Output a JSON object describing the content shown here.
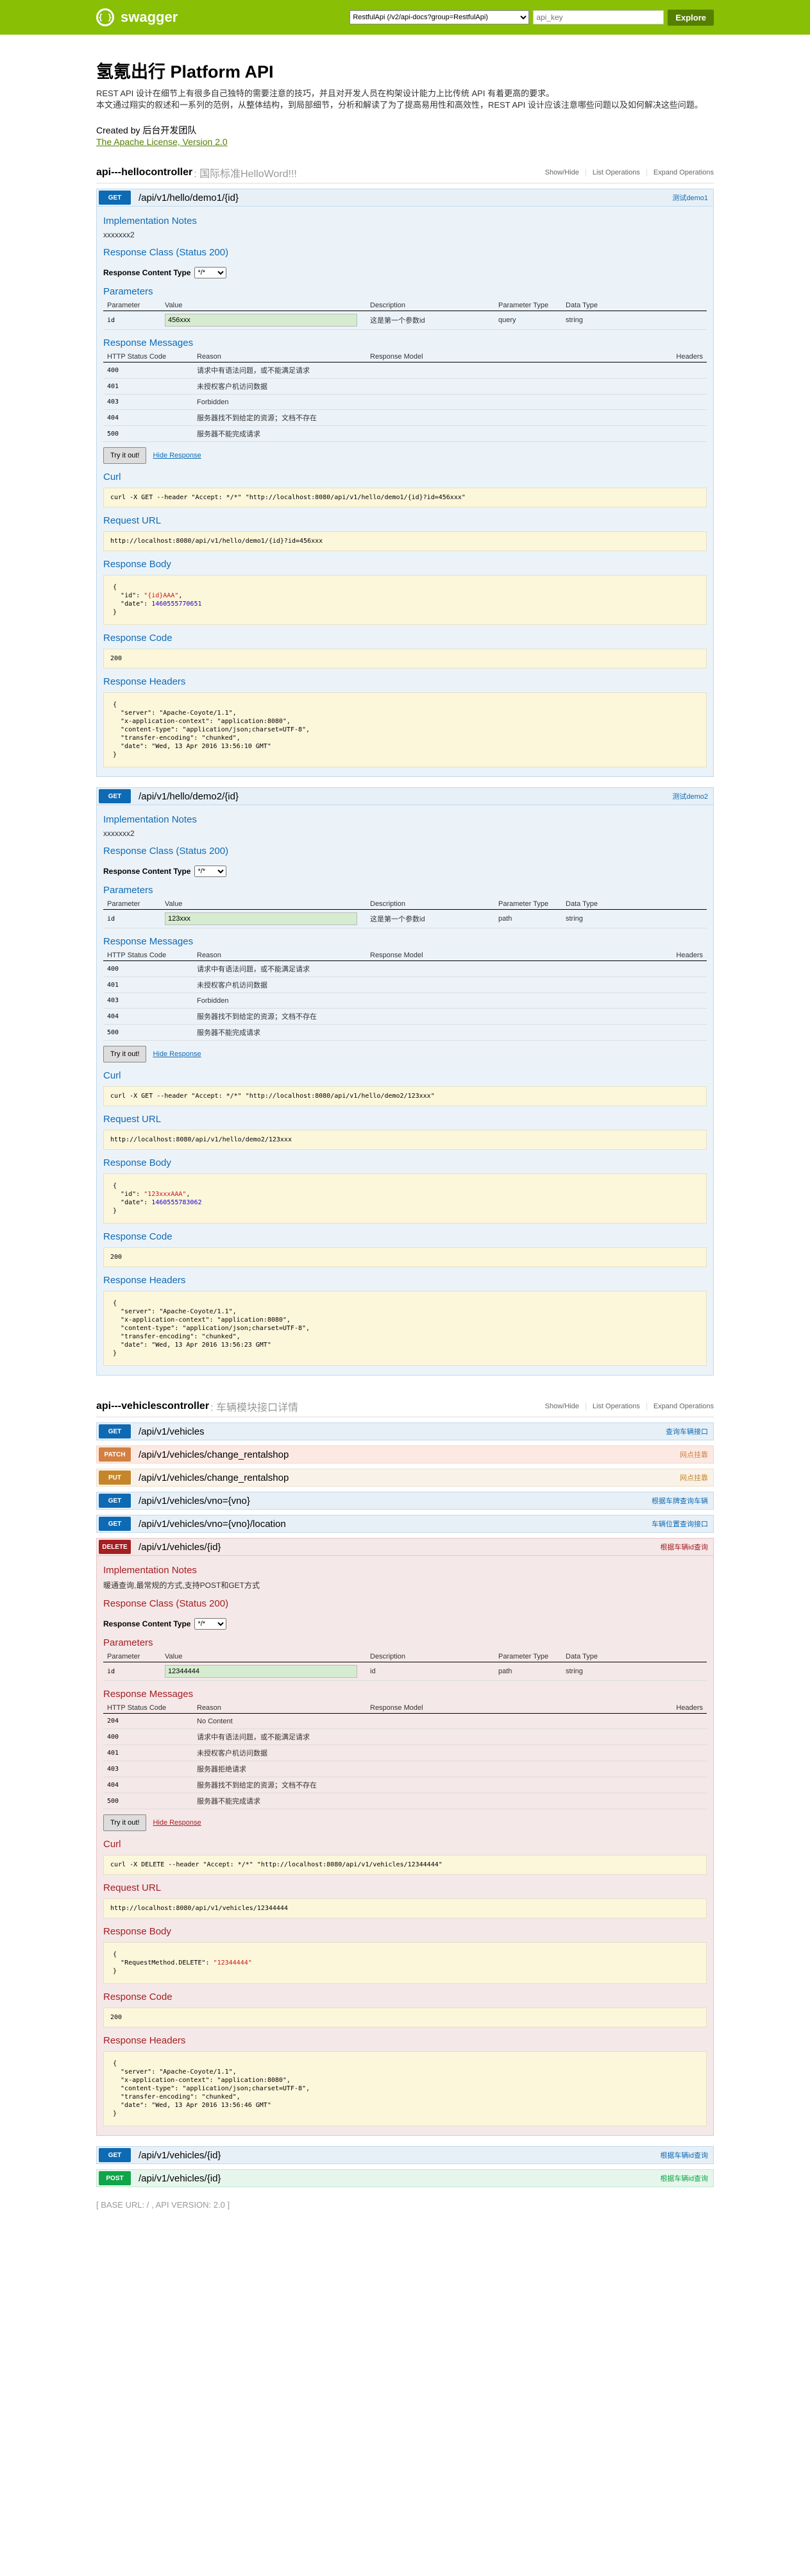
{
  "header": {
    "logo_text": "swagger",
    "logo_icon": "swagger-logo-icon",
    "select_value": "RestfulApi (/v2/api-docs?group=RestfulApi)",
    "input_placeholder": "api_key",
    "explore_label": "Explore"
  },
  "info": {
    "title": "氢氪出行 Platform API",
    "desc_line1": "REST API 设计在细节上有很多自己独特的需要注意的技巧，并且对开发人员在构架设计能力上比传统 API 有着更高的要求。",
    "desc_line2": "本文通过翔实的叙述和一系列的范例，从整体结构，到局部细节，分析和解读了为了提高易用性和高效性，REST API 设计应该注意哪些问题以及如何解决这些问题。",
    "created_by": "Created by 后台开发团队",
    "license": "The Apache License, Version 2.0"
  },
  "resources": {
    "hello": {
      "name": "api---hellocontroller",
      "desc": ": 国际标准HelloWord!!!",
      "links": [
        "Show/Hide",
        "List Operations",
        "Expand Operations"
      ],
      "op1": {
        "method": "GET",
        "path": "/api/v1/hello/demo1/{id}",
        "summary": "测试demo1",
        "notes_label": "Implementation Notes",
        "notes": "xxxxxxx2",
        "response_class": "Response Class (Status 200)",
        "rct_label": "Response Content Type",
        "rct_value": "*/*",
        "params_label": "Parameters",
        "param_headers": [
          "Parameter",
          "Value",
          "Description",
          "Parameter Type",
          "Data Type"
        ],
        "param": {
          "name": "id",
          "value": "456xxx",
          "desc": "这是第一个参数id",
          "type": "query",
          "dtype": "string"
        },
        "messages_label": "Response Messages",
        "msg_headers": [
          "HTTP Status Code",
          "Reason",
          "Response Model",
          "Headers"
        ],
        "messages": [
          {
            "code": "400",
            "reason": "请求中有语法问题，或不能满足请求"
          },
          {
            "code": "401",
            "reason": "未授权客户机访问数据"
          },
          {
            "code": "403",
            "reason": "Forbidden"
          },
          {
            "code": "404",
            "reason": "服务器找不到给定的资源；文档不存在"
          },
          {
            "code": "500",
            "reason": "服务器不能完成请求"
          }
        ],
        "try_label": "Try it out!",
        "hide_label": "Hide Response",
        "curl_label": "Curl",
        "curl": "curl -X GET --header \"Accept: */*\" \"http://localhost:8080/api/v1/hello/demo1/{id}?id=456xxx\"",
        "url_label": "Request URL",
        "url": "http://localhost:8080/api/v1/hello/demo1/{id}?id=456xxx",
        "body_label": "Response Body",
        "body_key1": "\"id\"",
        "body_val1": "\"{id}AAA\"",
        "body_key2": "\"date\"",
        "body_val2": "1460555770651",
        "code_label": "Response Code",
        "code": "200",
        "headers_label": "Response Headers",
        "headers": "{\n  \"server\": \"Apache-Coyote/1.1\",\n  \"x-application-context\": \"application:8080\",\n  \"content-type\": \"application/json;charset=UTF-8\",\n  \"transfer-encoding\": \"chunked\",\n  \"date\": \"Wed, 13 Apr 2016 13:56:10 GMT\"\n}"
      },
      "op2": {
        "method": "GET",
        "path": "/api/v1/hello/demo2/{id}",
        "summary": "测试demo2",
        "notes_label": "Implementation Notes",
        "notes": "xxxxxxx2",
        "response_class": "Response Class (Status 200)",
        "rct_label": "Response Content Type",
        "rct_value": "*/*",
        "params_label": "Parameters",
        "param_headers": [
          "Parameter",
          "Value",
          "Description",
          "Parameter Type",
          "Data Type"
        ],
        "param": {
          "name": "id",
          "value": "123xxx",
          "desc": "这是第一个参数id",
          "type": "path",
          "dtype": "string"
        },
        "messages_label": "Response Messages",
        "msg_headers": [
          "HTTP Status Code",
          "Reason",
          "Response Model",
          "Headers"
        ],
        "messages": [
          {
            "code": "400",
            "reason": "请求中有语法问题，或不能满足请求"
          },
          {
            "code": "401",
            "reason": "未授权客户机访问数据"
          },
          {
            "code": "403",
            "reason": "Forbidden"
          },
          {
            "code": "404",
            "reason": "服务器找不到给定的资源；文档不存在"
          },
          {
            "code": "500",
            "reason": "服务器不能完成请求"
          }
        ],
        "try_label": "Try it out!",
        "hide_label": "Hide Response",
        "curl_label": "Curl",
        "curl": "curl -X GET --header \"Accept: */*\" \"http://localhost:8080/api/v1/hello/demo2/123xxx\"",
        "url_label": "Request URL",
        "url": "http://localhost:8080/api/v1/hello/demo2/123xxx",
        "body_label": "Response Body",
        "body_key1": "\"id\"",
        "body_val1": "\"123xxxAAA\"",
        "body_key2": "\"date\"",
        "body_val2": "1460555783062",
        "code_label": "Response Code",
        "code": "200",
        "headers_label": "Response Headers",
        "headers": "{\n  \"server\": \"Apache-Coyote/1.1\",\n  \"x-application-context\": \"application:8080\",\n  \"content-type\": \"application/json;charset=UTF-8\",\n  \"transfer-encoding\": \"chunked\",\n  \"date\": \"Wed, 13 Apr 2016 13:56:23 GMT\"\n}"
      }
    },
    "vehicles": {
      "name": "api---vehiclescontroller",
      "desc": ": 车辆模块接口详情",
      "links": [
        "Show/Hide",
        "List Operations",
        "Expand Operations"
      ],
      "ops": [
        {
          "method": "GET",
          "path": "/api/v1/vehicles",
          "summary": "查询车辆接口"
        },
        {
          "method": "PATCH",
          "path": "/api/v1/vehicles/change_rentalshop",
          "summary": "网点挂靠"
        },
        {
          "method": "PUT",
          "path": "/api/v1/vehicles/change_rentalshop",
          "summary": "网点挂靠"
        },
        {
          "method": "GET",
          "path": "/api/v1/vehicles/vno={vno}",
          "summary": "根据车牌查询车辆"
        },
        {
          "method": "GET",
          "path": "/api/v1/vehicles/vno={vno}/location",
          "summary": "车辆位置查询接口"
        }
      ],
      "del": {
        "method": "DELETE",
        "path": "/api/v1/vehicles/{id}",
        "summary": "根据车辆id查询",
        "notes_label": "Implementation Notes",
        "notes": "暖通查询,最常规的方式,支持POST和GET方式",
        "response_class": "Response Class (Status 200)",
        "rct_label": "Response Content Type",
        "rct_value": "*/*",
        "params_label": "Parameters",
        "param_headers": [
          "Parameter",
          "Value",
          "Description",
          "Parameter Type",
          "Data Type"
        ],
        "param": {
          "name": "id",
          "value": "12344444",
          "desc": "id",
          "type": "path",
          "dtype": "string"
        },
        "messages_label": "Response Messages",
        "msg_headers": [
          "HTTP Status Code",
          "Reason",
          "Response Model",
          "Headers"
        ],
        "messages": [
          {
            "code": "204",
            "reason": "No Content"
          },
          {
            "code": "400",
            "reason": "请求中有语法问题，或不能满足请求"
          },
          {
            "code": "401",
            "reason": "未授权客户机访问数据"
          },
          {
            "code": "403",
            "reason": "服务器拒绝请求"
          },
          {
            "code": "404",
            "reason": "服务器找不到给定的资源；文档不存在"
          },
          {
            "code": "500",
            "reason": "服务器不能完成请求"
          }
        ],
        "try_label": "Try it out!",
        "hide_label": "Hide Response",
        "curl_label": "Curl",
        "curl": "curl -X DELETE --header \"Accept: */*\" \"http://localhost:8080/api/v1/vehicles/12344444\"",
        "url_label": "Request URL",
        "url": "http://localhost:8080/api/v1/vehicles/12344444",
        "body_label": "Response Body",
        "body_key1": "\"RequestMethod.DELETE\"",
        "body_val1": "\"12344444\"",
        "code_label": "Response Code",
        "code": "200",
        "headers_label": "Response Headers",
        "headers": "{\n  \"server\": \"Apache-Coyote/1.1\",\n  \"x-application-context\": \"application:8080\",\n  \"content-type\": \"application/json;charset=UTF-8\",\n  \"transfer-encoding\": \"chunked\",\n  \"date\": \"Wed, 13 Apr 2016 13:56:46 GMT\"\n}"
      },
      "tail_ops": [
        {
          "method": "GET",
          "path": "/api/v1/vehicles/{id}",
          "summary": "根据车辆id查询"
        },
        {
          "method": "POST",
          "path": "/api/v1/vehicles/{id}",
          "summary": "根据车辆id查询"
        }
      ]
    }
  },
  "footer": {
    "text": "[ BASE URL: / , API VERSION: 2.0 ]"
  },
  "colors": {
    "header": "#89bf04",
    "get": "#0f6ab4",
    "post": "#10a54a",
    "put": "#c5862b",
    "patch": "#d38042",
    "delete": "#a41e22"
  }
}
